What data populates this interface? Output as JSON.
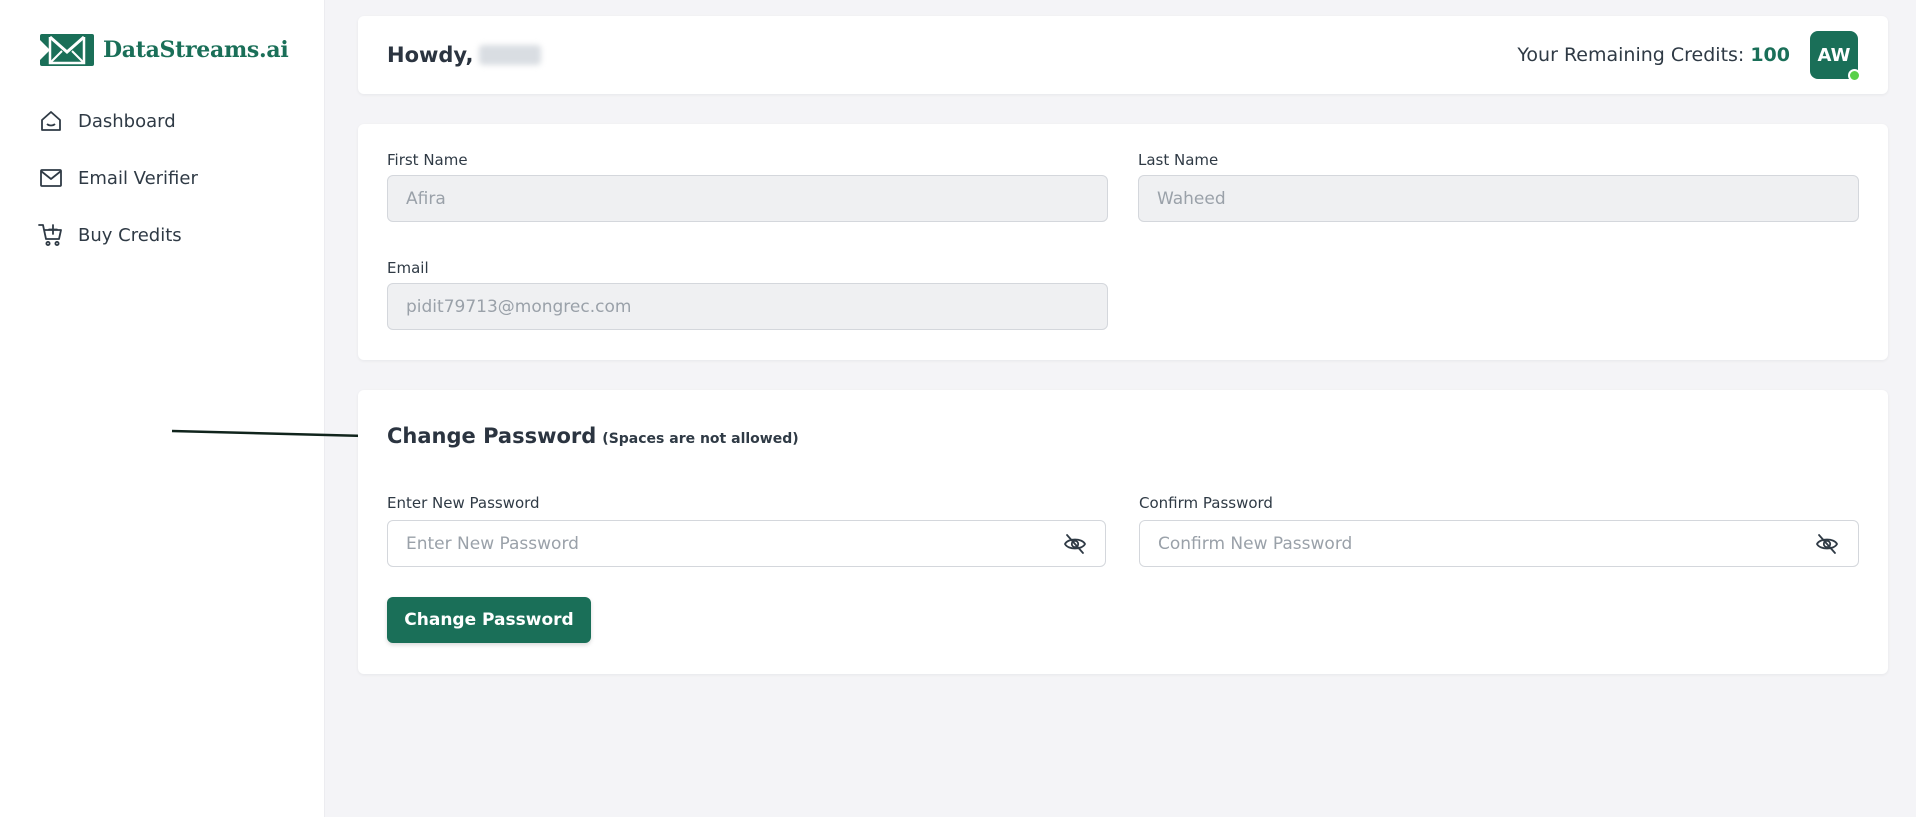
{
  "brand": {
    "name": "DataStreams.ai",
    "color": "#1a6f58"
  },
  "sidebar": {
    "items": [
      {
        "label": "Dashboard",
        "icon": "home-icon"
      },
      {
        "label": "Email Verifier",
        "icon": "mail-icon"
      },
      {
        "label": "Buy Credits",
        "icon": "cart-icon"
      }
    ]
  },
  "header": {
    "greeting": "Howdy,",
    "credits_label": "Your Remaining Credits:",
    "credits_value": "100",
    "avatar_initials": "AW",
    "status_color": "#5ad04a"
  },
  "profile": {
    "first_name_label": "First Name",
    "first_name_value": "Afira",
    "last_name_label": "Last Name",
    "last_name_value": "Waheed",
    "email_label": "Email",
    "email_value": "pidit79713@mongrec.com"
  },
  "password": {
    "title": "Change Password",
    "note": "(Spaces are not allowed)",
    "new_label": "Enter New Password",
    "new_placeholder": "Enter New Password",
    "confirm_label": "Confirm Password",
    "confirm_placeholder": "Confirm New Password",
    "button_label": "Change Password",
    "toggle_icon": "eye-off-icon"
  }
}
